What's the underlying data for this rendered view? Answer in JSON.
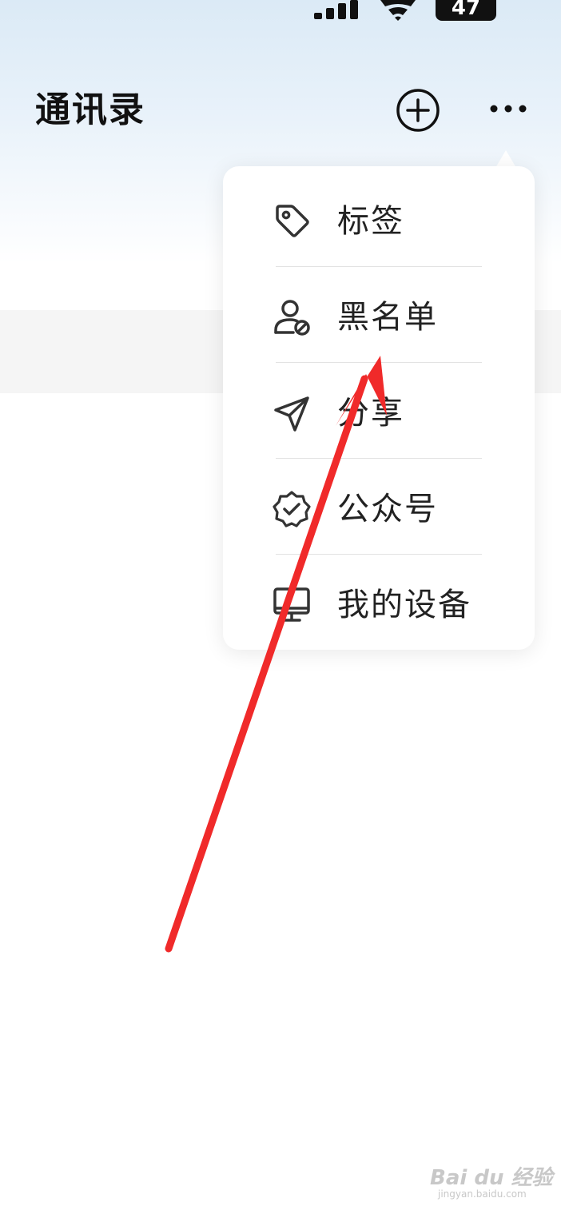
{
  "status_bar": {
    "battery": "47"
  },
  "header": {
    "title": "通讯录"
  },
  "menu": {
    "items": [
      {
        "label": "标签",
        "icon": "tag-icon"
      },
      {
        "label": "黑名单",
        "icon": "user-block-icon"
      },
      {
        "label": "分享",
        "icon": "send-icon"
      },
      {
        "label": "公众号",
        "icon": "verified-badge-icon"
      },
      {
        "label": "我的设备",
        "icon": "monitor-icon"
      }
    ]
  },
  "watermark": {
    "main": "Bai du 经验",
    "sub": "jingyan.baidu.com"
  },
  "colors": {
    "annotation": "#f02a2a",
    "header_gradient_top": "#dbeaf6"
  }
}
